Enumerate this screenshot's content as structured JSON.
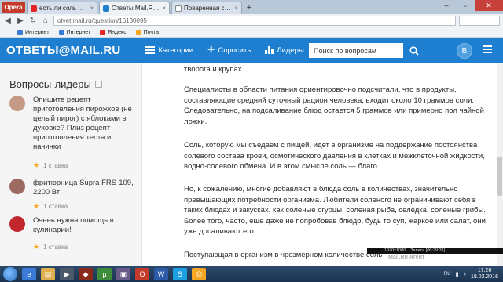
{
  "browser": {
    "opera_label": "Opera",
    "tabs": [
      {
        "label": "есть ли соль в овощах -",
        "color": "#e3242b"
      },
      {
        "label": "Ответы Mail.Ru: Вредно...",
        "color": "#1e7fd0",
        "active": true
      },
      {
        "label": "Поваренная соль — Вик...",
        "color": "#ffffff"
      }
    ],
    "new_tab": "+",
    "url": "otvet.mail.ru/question/16130095",
    "bookmarks": [
      "Интернет",
      "Интернет",
      "Яндекс",
      "Почта"
    ]
  },
  "header": {
    "logo": "ОТВЕТЫ@MAIL.RU",
    "nav": {
      "categories": "Категории",
      "ask": "Спросить",
      "leaders": "Лидеры"
    },
    "search_placeholder": "Поиск по вопросам",
    "avatar_letter": "В"
  },
  "sidebar": {
    "title": "Вопросы-лидеры",
    "questions": [
      {
        "text": "Опишите рецепт приготовления пирожков (не целый пирог) с яблоками в духовке? Плиз рецепт приготовления теста и начинки",
        "rating": "1 ставка",
        "avatar_color": "#c49a86"
      },
      {
        "text": "фритюрница Supra FRS-109, 2200 Вт",
        "rating": "1 ставка",
        "avatar_color": "#9d6a62"
      },
      {
        "text": "Очень нужна помощь в кулинарии!",
        "rating": "1 ставка",
        "avatar_color": "#c1272d"
      }
    ]
  },
  "article": {
    "paragraphs": [
      "творога и крупах.",
      "Специалисты в области питания ориентировочно подсчитали, что в продукты, составляющие средний суточный рацион человека, входит около 10 граммов соли. Следовательно, на подсаливание блюд остается 5 граммов или примерно пол чайной ложки.",
      "Соль, которую мы съедаем с пищей, идет в организме на поддержание постоянства солевого состава крови, осмотического давления в клетках и межклеточной жидкости, водно-солевого обмена. И в этом смысле соль — благо.",
      "Но, к сожалению, многие добавляют в блюда соль в количествах, значительно превышающих потребности организма. Любители соленого не ограничивают себя в таких блюдах и закусках, как соленые огурцы, соленая рыба, селедка, соленые грибы. Более того, часто, еще даже не попробовав блюдо, будь то суп, жаркое или салат, они уже досаливают его.",
      "Поступающая в организм в чрезмерном количестве соль"
    ]
  },
  "recording": {
    "resolution": "1920x1080",
    "status": "Запись [00:29:31]",
    "logo": "Mail.Ru Агент"
  },
  "taskbar": {
    "lang": "RU",
    "time": "17:26",
    "date": "18.02.2016"
  }
}
